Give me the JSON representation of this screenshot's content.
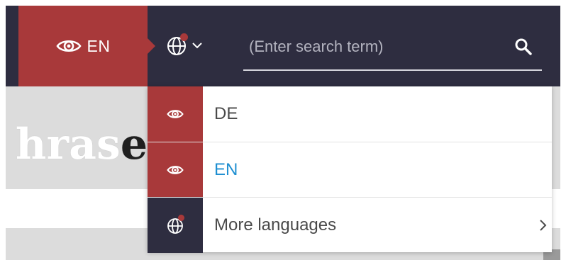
{
  "header": {
    "current_language": "EN",
    "search": {
      "placeholder": "(Enter search term)",
      "value": ""
    }
  },
  "background": {
    "heading_light": "hras",
    "heading_dark": "e"
  },
  "dropdown": {
    "items": [
      {
        "label": "DE",
        "icon": "eye-icon",
        "active": false
      },
      {
        "label": "EN",
        "icon": "eye-icon",
        "active": true
      },
      {
        "label": "More languages",
        "icon": "globe-icon",
        "submenu": true
      }
    ]
  },
  "colors": {
    "brand_red": "#a8393a",
    "navy": "#2e2d40",
    "active_link": "#1f8fd1"
  }
}
